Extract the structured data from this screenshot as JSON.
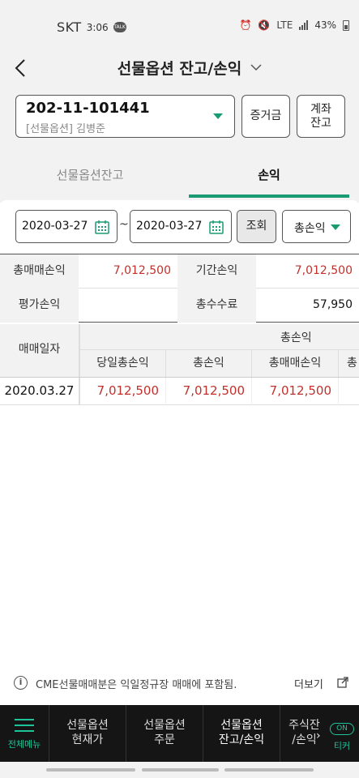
{
  "status_bar": {
    "carrier": "SKT",
    "time": "3:06",
    "talk_icon": "TALK",
    "network": "LTE",
    "battery": "43%"
  },
  "header": {
    "title": "선물옵션 잔고/손익"
  },
  "account": {
    "number": "202-11-101441",
    "name": "[선물옵션] 김병준"
  },
  "buttons": {
    "margin": "증거금",
    "account_balance_line1": "계좌",
    "account_balance_line2": "잔고"
  },
  "tabs": [
    {
      "label": "선물옵션잔고",
      "active": false
    },
    {
      "label": "손익",
      "active": true
    }
  ],
  "filters": {
    "date_from": "2020-03-27",
    "separator": "~",
    "date_to": "2020-03-27",
    "query_label": "조회",
    "select_value": "총손익"
  },
  "summary": [
    {
      "label": "총매매손익",
      "value": "7,012,500",
      "label2": "기간손익",
      "value2": "7,012,500"
    },
    {
      "label": "평가손익",
      "value": "",
      "label2": "총수수료",
      "value2": "57,950"
    }
  ],
  "detail": {
    "date_header": "매매일자",
    "group_header": "총손익",
    "sub_headers": [
      "당일총손익",
      "총손익",
      "총매매손익",
      "총"
    ],
    "rows": [
      {
        "date": "2020.03.27",
        "daily_total": "7,012,500",
        "total": "7,012,500",
        "trade_total": "7,012,500"
      }
    ]
  },
  "notice": {
    "text": "CME선물매매분은 익일정규장 매매에 포함됨.",
    "more_label": "더보기"
  },
  "bottom_nav": {
    "menu_label": "전체메뉴",
    "items": [
      {
        "line1": "선물옵션",
        "line2": "현재가"
      },
      {
        "line1": "선물옵션",
        "line2": "주문"
      },
      {
        "line1": "선물옵션",
        "line2": "잔고/손익"
      },
      {
        "line1": "주식잔",
        "line2": "/손익"
      }
    ],
    "ticker_on": "ON",
    "ticker_label": "티커"
  },
  "colors": {
    "accent": "#1a9a73",
    "loss_profit_red": "#c0312b",
    "nav_bg": "#151515"
  }
}
